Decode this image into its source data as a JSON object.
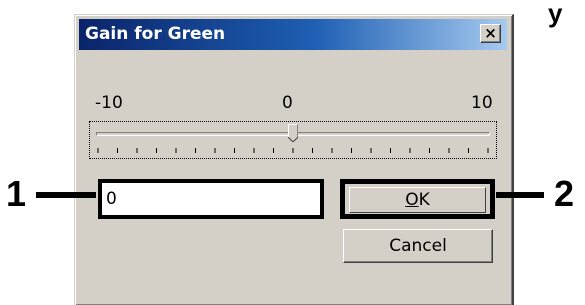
{
  "corner_fragment": "y",
  "dialog": {
    "title": "Gain for Green",
    "close_glyph": "×",
    "slider": {
      "min_label": "-10",
      "mid_label": "0",
      "max_label": "10",
      "min": -10,
      "max": 10,
      "value": 0
    },
    "input_value": "0",
    "ok_label_prefix": "",
    "ok_label_underlined": "O",
    "ok_label_rest": "K",
    "cancel_label": "Cancel"
  },
  "callouts": {
    "left": "1",
    "right": "2"
  }
}
